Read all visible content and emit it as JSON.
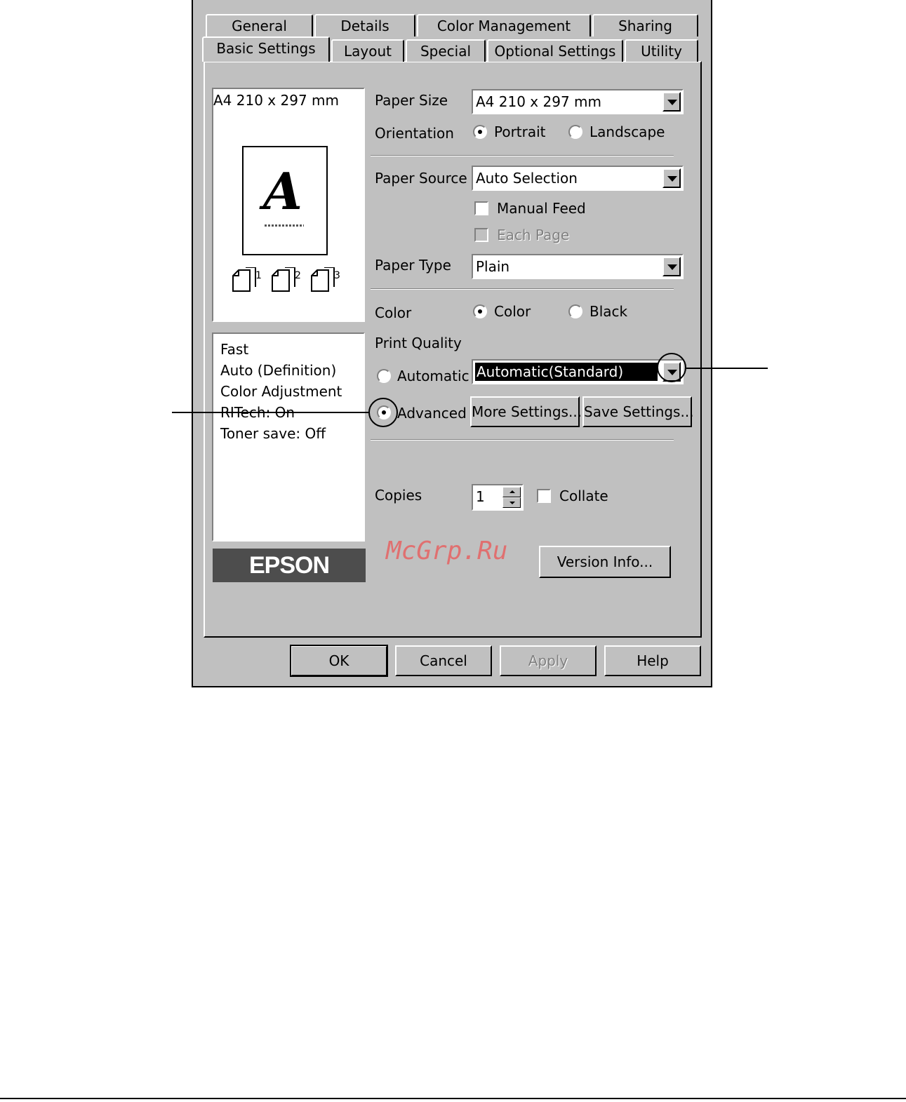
{
  "tabs_row_back": [
    "General",
    "Details",
    "Color Management",
    "Sharing"
  ],
  "tabs_row_front": [
    "Basic Settings",
    "Layout",
    "Special",
    "Optional Settings",
    "Utility"
  ],
  "preview": {
    "paper_label": "A4 210 x 297 mm",
    "letter": "A",
    "layout_numbers": [
      "1",
      "2",
      "3"
    ]
  },
  "summary": [
    "Fast",
    "Auto (Definition)",
    "Color Adjustment",
    "RITech: On",
    "Toner save: Off"
  ],
  "logo": "EPSON",
  "watermark": "McGrp.Ru",
  "paper_size": {
    "label": "Paper Size",
    "value": "A4 210 x 297 mm"
  },
  "orientation": {
    "label": "Orientation",
    "options": [
      "Portrait",
      "Landscape"
    ],
    "selected": "Portrait"
  },
  "paper_source": {
    "label": "Paper Source",
    "value": "Auto Selection"
  },
  "manual_feed": {
    "label": "Manual Feed",
    "checked": false
  },
  "each_page": {
    "label": "Each Page",
    "checked": false,
    "disabled": true
  },
  "paper_type": {
    "label": "Paper Type",
    "value": "Plain"
  },
  "color": {
    "label": "Color",
    "options": [
      "Color",
      "Black"
    ],
    "selected": "Color"
  },
  "print_quality": {
    "label": "Print Quality",
    "automatic_label": "Automatic",
    "advanced_label": "Advanced",
    "selected": "Advanced",
    "combo_value": "Automatic(Standard)"
  },
  "buttons": {
    "more_settings": "More Settings...",
    "save_settings": "Save Settings...",
    "version_info": "Version Info...",
    "ok": "OK",
    "cancel": "Cancel",
    "apply": "Apply",
    "help": "Help"
  },
  "copies": {
    "label": "Copies",
    "value": "1"
  },
  "collate": {
    "label": "Collate",
    "checked": false
  }
}
